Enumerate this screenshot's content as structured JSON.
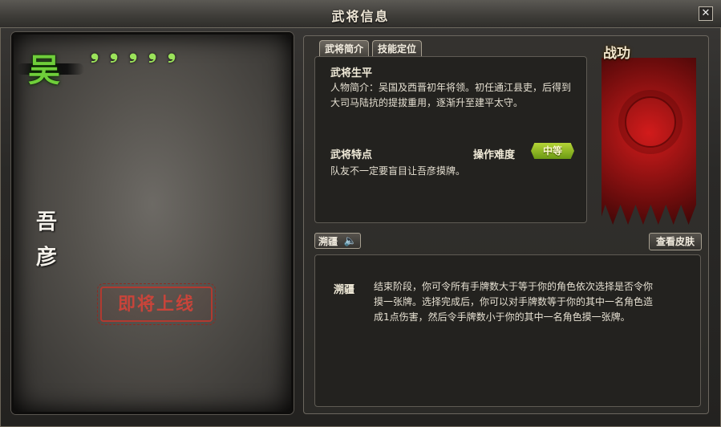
{
  "window": {
    "title": "武将信息",
    "close_label": "✕"
  },
  "general": {
    "kingdom_glyph": "吴",
    "name_chars": [
      "吾",
      "彦"
    ],
    "hp_marks": [
      "❟",
      "❟",
      "❟",
      "❟",
      "❟"
    ],
    "stamp": "即将上线",
    "kingdom_color": "#6fcf3a"
  },
  "tabs": [
    {
      "label": "武将简介",
      "active": true
    },
    {
      "label": "技能定位",
      "active": false
    }
  ],
  "intro": {
    "bio_title": "武将生平",
    "bio_text": "人物简介：吴国及西晋初年将领。初任通江县吏，后得到大司马陆抗的提拔重用，逐渐升至建平太守。",
    "traits_title": "武将特点",
    "difficulty_label": "操作难度",
    "difficulty_value": "中等",
    "traits_text": "队友不一定要盲目让吾彦摸牌。"
  },
  "banner": {
    "label": "战功",
    "color": "#c8161b"
  },
  "skill": {
    "button_label": "溯疆",
    "speaker_icon": "speaker-icon",
    "skin_button": "查看皮肤",
    "name": "溯疆",
    "description": "结束阶段，你可令所有手牌数大于等于你的角色依次选择是否令你摸一张牌。选择完成后，你可以对手牌数等于你的其中一名角色造成1点伤害，然后令手牌数小于你的其中一名角色摸一张牌。"
  }
}
